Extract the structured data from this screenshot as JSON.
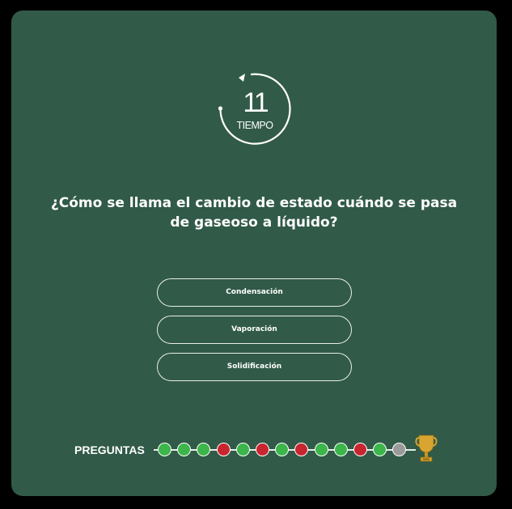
{
  "timer": {
    "value": "11",
    "label": "TIEMPO"
  },
  "question": "¿Cómo se llama el cambio de estado cuándo se pasa de gaseoso a líquido?",
  "options": [
    {
      "label": "Condensación"
    },
    {
      "label": "Vaporación"
    },
    {
      "label": "Solidificación"
    }
  ],
  "progress": {
    "label": "PREGUNTAS",
    "states": [
      "correct",
      "correct",
      "correct",
      "wrong",
      "correct",
      "wrong",
      "correct",
      "wrong",
      "correct",
      "correct",
      "wrong",
      "correct",
      "pending"
    ]
  },
  "colors": {
    "background": "#315a48",
    "correct": "#3cb54a",
    "wrong": "#c8252e",
    "pending": "#9a9a9a",
    "trophy": "#d9a531"
  },
  "icons": {
    "timer": "circular-arrow-icon",
    "goal": "trophy-icon"
  }
}
